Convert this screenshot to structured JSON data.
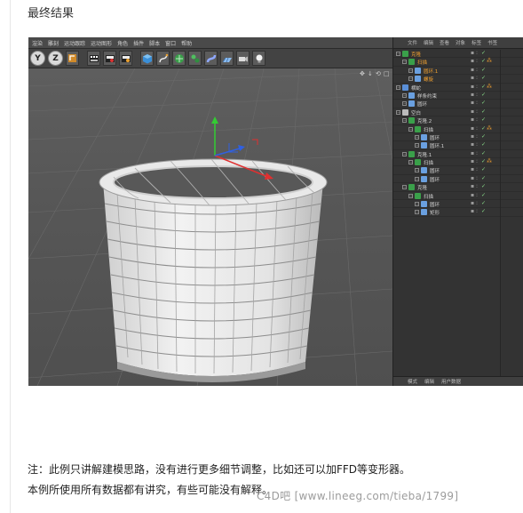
{
  "heading": "最终结果",
  "c4d_menu": [
    "渲染",
    "雕刻",
    "运动跟踪",
    "运动图形",
    "角色",
    "插件",
    "脚本",
    "窗口",
    "帮助"
  ],
  "toolbar": {
    "axis_y": "Y",
    "axis_z": "Z"
  },
  "objects_panel": {
    "menu": [
      "文件",
      "编辑",
      "查看",
      "对象",
      "标签",
      "书签"
    ],
    "bottom_tabs": [
      "模式",
      "编辑",
      "用户数据"
    ],
    "items": [
      {
        "name": "克隆",
        "selected": true
      },
      {
        "name": "扫描",
        "selected": true
      },
      {
        "name": "圆环.1",
        "selected": true
      },
      {
        "name": "螺旋",
        "selected": true
      },
      {
        "name": "横蛇",
        "selected": false
      },
      {
        "name": "样条约束",
        "selected": false
      },
      {
        "name": "圆环",
        "selected": false
      },
      {
        "name": "空白",
        "selected": false
      },
      {
        "name": "克隆.2",
        "selected": false
      },
      {
        "name": "扫描",
        "selected": false
      },
      {
        "name": "圆环",
        "selected": false
      },
      {
        "name": "圆环.1",
        "selected": false
      },
      {
        "name": "克隆.1",
        "selected": false
      },
      {
        "name": "扫描",
        "selected": false
      },
      {
        "name": "圆环",
        "selected": false
      },
      {
        "name": "圆环",
        "selected": false
      },
      {
        "name": "克隆",
        "selected": false
      },
      {
        "name": "扫描",
        "selected": false
      },
      {
        "name": "圆环",
        "selected": false
      },
      {
        "name": "矩形",
        "selected": false
      }
    ]
  },
  "note_line1": "注：此例只讲解建模思路，没有进行更多细节调整，比如还可以加FFD等变形器。",
  "note_line2": "本例所使用所有数据都有讲究，有些可能没有解释。",
  "watermark": "C4D吧 [www.lineeg.com/tieba/1799]",
  "colors": {
    "selected_text": "#f0a030",
    "viewport_bg": "#575757",
    "panel_bg": "#333333"
  }
}
